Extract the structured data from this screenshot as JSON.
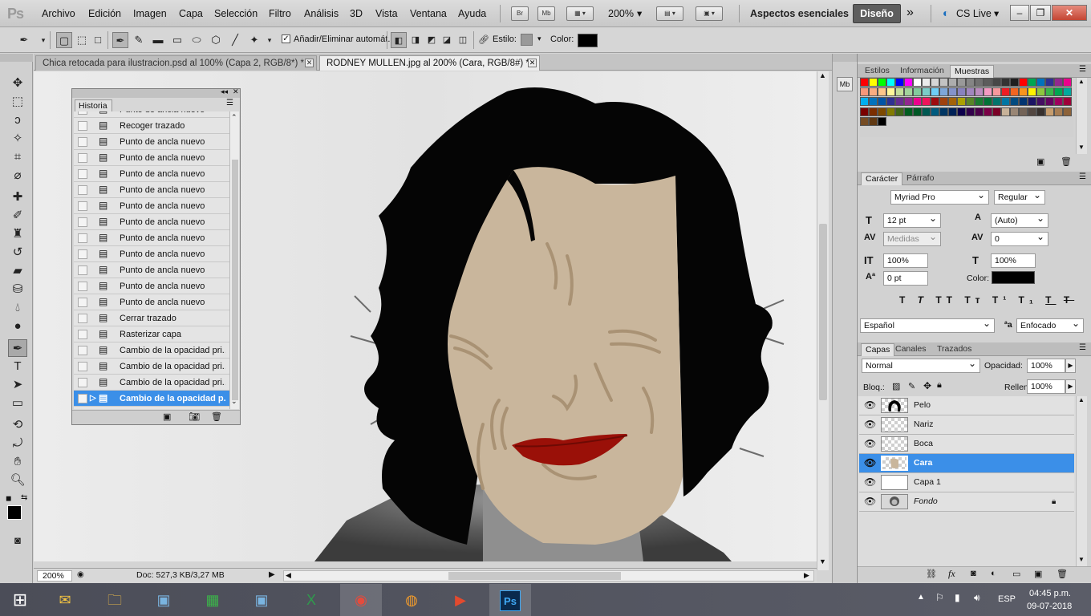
{
  "menubar": {
    "logo": "Ps",
    "items": [
      "Archivo",
      "Edición",
      "Imagen",
      "Capa",
      "Selección",
      "Filtro",
      "Análisis",
      "3D",
      "Vista",
      "Ventana",
      "Ayuda"
    ],
    "btn_br": "Br",
    "btn_mb": "Mb",
    "zoom": "200%",
    "workspace_essentials": "Aspectos esenciales",
    "workspace_design": "Diseño",
    "cs_live": "CS Live"
  },
  "options": {
    "auto_add_delete": "Añadir/Eliminar automát.",
    "auto_add_delete_checked": true,
    "style_label": "Estilo:",
    "color_label": "Color:",
    "color_value": "#000000"
  },
  "tabs": [
    {
      "label": "Chica retocada para ilustracion.psd al 100% (Capa 2, RGB/8*) *"
    },
    {
      "label": "RODNEY MULLEN.jpg al 200% (Cara, RGB/8#) *"
    }
  ],
  "history": {
    "title": "Historia",
    "items": [
      "Punto de ancla nuevo",
      "Recoger trazado",
      "Punto de ancla nuevo",
      "Punto de ancla nuevo",
      "Punto de ancla nuevo",
      "Punto de ancla nuevo",
      "Punto de ancla nuevo",
      "Punto de ancla nuevo",
      "Punto de ancla nuevo",
      "Punto de ancla nuevo",
      "Punto de ancla nuevo",
      "Punto de ancla nuevo",
      "Punto de ancla nuevo",
      "Cerrar trazado",
      "Rasterizar capa",
      "Cambio de la opacidad pri...",
      "Cambio de la opacidad pri...",
      "Cambio de la opacidad pri...",
      "Cambio de la opacidad p..."
    ]
  },
  "status": {
    "zoom": "200%",
    "doc_info": "Doc: 527,3 KB/3,27 MB"
  },
  "panels": {
    "swatch_tabs": [
      "Estilos",
      "Información",
      "Muestras"
    ],
    "char_tabs": [
      "Carácter",
      "Párrafo"
    ],
    "font_family": "Myriad Pro",
    "font_style": "Regular",
    "font_size": "12 pt",
    "leading": "(Auto)",
    "kerning": "Medidas",
    "tracking": "0",
    "vscale": "100%",
    "hscale": "100%",
    "baseline": "0 pt",
    "color_label": "Color:",
    "language": "Español",
    "aa_label": "ªa",
    "antialias": "Enfocado",
    "layer_tabs": [
      "Capas",
      "Canales",
      "Trazados"
    ],
    "blend_mode": "Normal",
    "opacity_label": "Opacidad:",
    "opacity": "100%",
    "lock_label": "Bloq.:",
    "fill_label": "Relleno:",
    "fill": "100%",
    "layers": [
      "Pelo",
      "Nariz",
      "Boca",
      "Cara",
      "Capa 1",
      "Fondo"
    ],
    "selected_layer": "Cara"
  },
  "taskbar": {
    "lang": "ESP",
    "time": "04:45 p.m.",
    "date": "09-07-2018"
  },
  "colors": {
    "accent": "#3b8fe8",
    "skin": "#c9b69c",
    "lips": "#9a1008"
  }
}
